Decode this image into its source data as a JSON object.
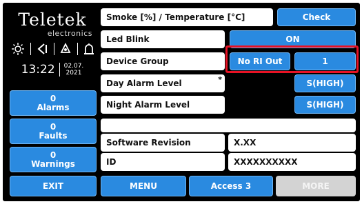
{
  "brand": {
    "name": "Teletek",
    "sub": "electronics"
  },
  "status_icons": [
    "sun-icon",
    "signal-icon",
    "alarm-bell-icon",
    "siren-icon"
  ],
  "clock": {
    "time": "13:22",
    "date_line1": "02.07.",
    "date_line2": "2021"
  },
  "counters": [
    {
      "count": "0",
      "label": "Alarms"
    },
    {
      "count": "0",
      "label": "Faults"
    },
    {
      "count": "0",
      "label": "Warnings"
    }
  ],
  "params": {
    "smoke_label": "Smoke [%] / Temperature [°C]",
    "check_label": "Check",
    "led_blink_label": "Led Blink",
    "led_blink_value": "ON",
    "device_group_label": "Device Group",
    "device_group_mode": "No RI Out",
    "device_group_value": "1",
    "day_alarm_label": "Day Alarm Level",
    "day_alarm_marker": "*",
    "day_alarm_value": "S(HIGH)",
    "night_alarm_label": "Night Alarm Level",
    "night_alarm_value": "S(HIGH)",
    "software_label": "Software Revision",
    "software_value": "X.XX",
    "id_label": "ID",
    "id_value": "XXXXXXXXXX"
  },
  "bottom": {
    "exit": "EXIT",
    "menu": "MENU",
    "access": "Access 3",
    "more": "MORE"
  },
  "colors": {
    "accent": "#2a8ae0",
    "background": "#000000",
    "highlight": "#e81224",
    "disabled": "#d3d3d3"
  }
}
